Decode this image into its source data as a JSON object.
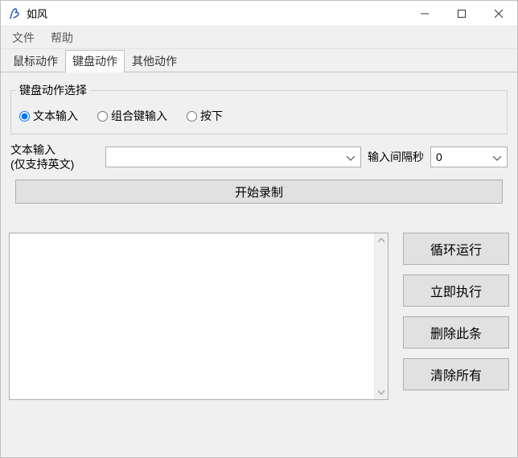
{
  "window": {
    "title": "如风"
  },
  "menu": {
    "file": "文件",
    "help": "帮助"
  },
  "tabs": {
    "mouse": "鼠标动作",
    "keyboard": "键盘动作",
    "other": "其他动作"
  },
  "group": {
    "legend": "键盘动作选择",
    "radio_text": "文本输入",
    "radio_combo": "组合键输入",
    "radio_press": "按下"
  },
  "row": {
    "label_line1": "文本输入",
    "label_line2": "(仅支持英文)",
    "combo_value": "",
    "interval_label": "输入间隔秒",
    "interval_value": "0"
  },
  "record_button": "开始录制",
  "side": {
    "loop": "循环运行",
    "run": "立即执行",
    "delete": "删除此条",
    "clear": "清除所有"
  }
}
